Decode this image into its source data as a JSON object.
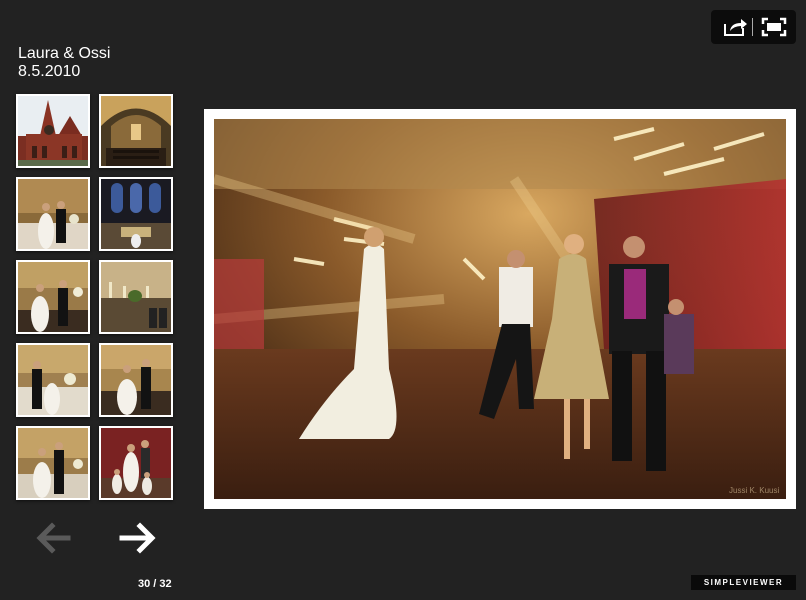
{
  "gallery": {
    "title": "Laura & Ossi",
    "date": "8.5.2010"
  },
  "thumbnails": [
    {
      "subject": "church-exterior"
    },
    {
      "subject": "church-interior"
    },
    {
      "subject": "couple-at-altar"
    },
    {
      "subject": "church-windows"
    },
    {
      "subject": "couple-vows"
    },
    {
      "subject": "altar-candles"
    },
    {
      "subject": "couple-kneeling"
    },
    {
      "subject": "couple-exchange"
    },
    {
      "subject": "couple-standing"
    },
    {
      "subject": "family-group"
    }
  ],
  "navigation": {
    "prev_icon": "arrow-left-icon",
    "next_icon": "arrow-right-icon",
    "counter": "30 / 32"
  },
  "toolbar": {
    "share_icon": "share-icon",
    "fullscreen_icon": "fullscreen-icon"
  },
  "photo": {
    "watermark": "Jussi K. Kuusi"
  },
  "branding": {
    "label": "SIMPLEVIEWER"
  },
  "colors": {
    "background": "#222222",
    "frame": "#ffffff",
    "toolbar": "#0c0c0c"
  }
}
